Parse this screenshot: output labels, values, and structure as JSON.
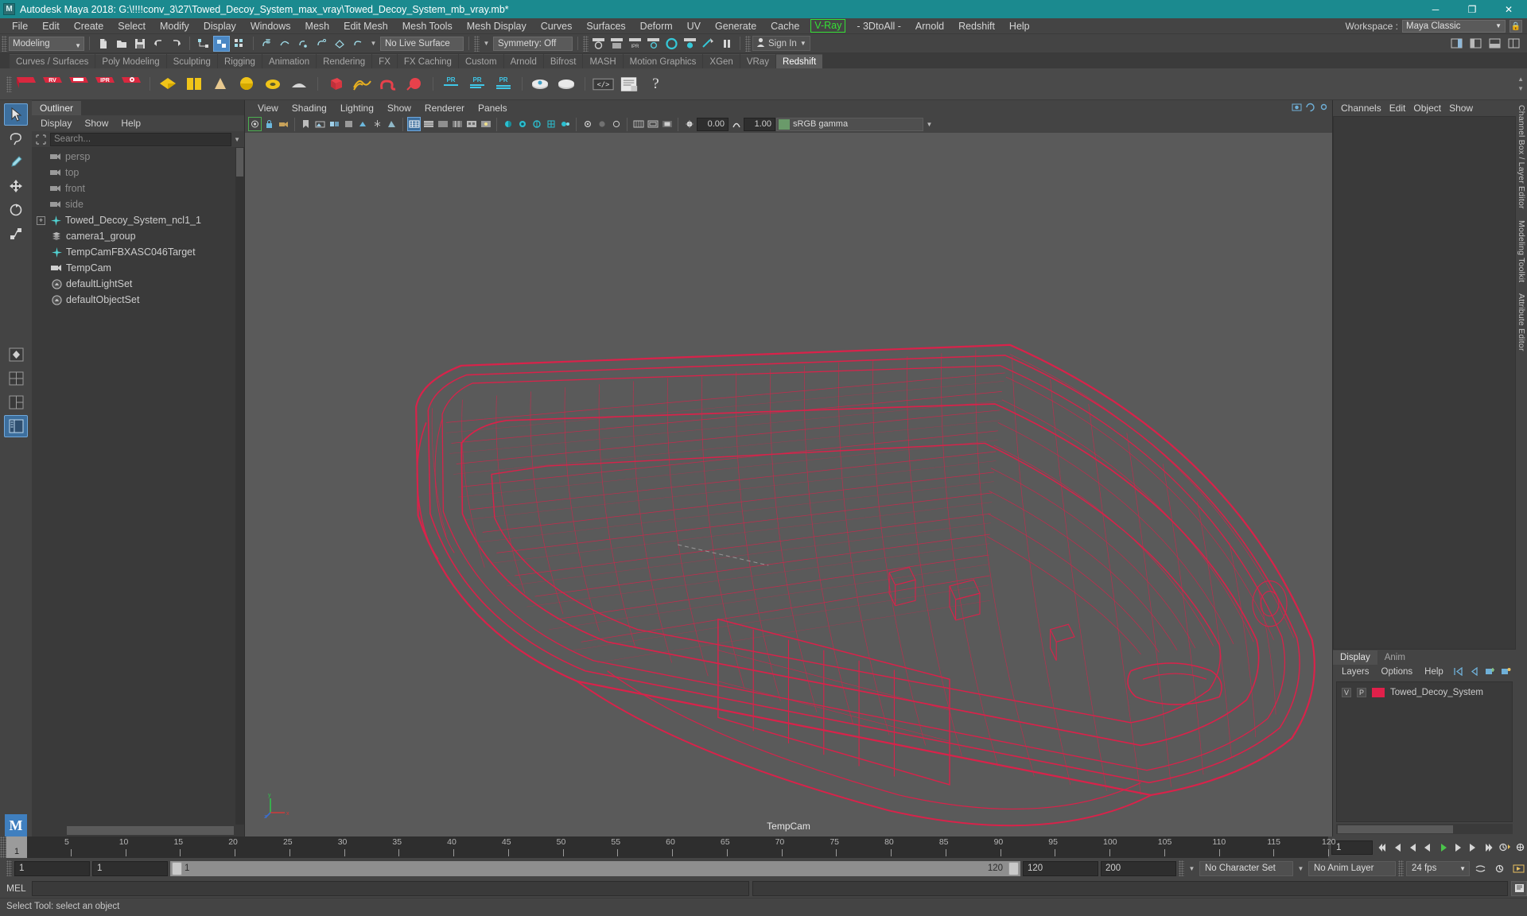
{
  "window": {
    "title": "Autodesk Maya 2018: G:\\!!!!conv_3\\27\\Towed_Decoy_System_max_vray\\Towed_Decoy_System_mb_vray.mb*",
    "app_icon": "maya-icon",
    "minimize": "─",
    "maximize": "❐",
    "close": "✕",
    "titlebar_color": "#1b8a8f"
  },
  "menubar": {
    "items": [
      "File",
      "Edit",
      "Create",
      "Select",
      "Modify",
      "Display",
      "Windows",
      "Mesh",
      "Edit Mesh",
      "Mesh Tools",
      "Mesh Display",
      "Curves",
      "Surfaces",
      "Deform",
      "UV",
      "Generate",
      "Cache"
    ],
    "vray": "V-Ray",
    "after_vray": [
      "- 3DtoAll -",
      "Arnold",
      "Redshift",
      "Help"
    ],
    "workspace_label": "Workspace :",
    "workspace_value": "Maya Classic",
    "vray_color": "#35e035"
  },
  "statusline": {
    "mode": "Modeling",
    "live_surface": "No Live Surface",
    "symmetry": "Symmetry: Off",
    "signin": "Sign In",
    "num1": "0.00",
    "num2": "1.00"
  },
  "shelf": {
    "tabs": [
      "Curves / Surfaces",
      "Poly Modeling",
      "Sculpting",
      "Rigging",
      "Animation",
      "Rendering",
      "FX",
      "FX Caching",
      "Custom",
      "Arnold",
      "Bifrost",
      "MASH",
      "Motion Graphics",
      "XGen",
      "VRay",
      "Redshift"
    ],
    "active_tab": "Redshift",
    "icon_labels": [
      "RV",
      "",
      "IPR",
      "",
      "",
      "",
      "",
      "",
      "",
      "",
      "",
      "",
      "",
      "",
      "",
      "PR",
      "PR",
      "PR",
      "",
      "",
      "",
      "",
      "?"
    ]
  },
  "outliner": {
    "tab": "Outliner",
    "menus": [
      "Display",
      "Show",
      "Help"
    ],
    "search_placeholder": "Search...",
    "items": [
      {
        "label": "persp",
        "icon": "camera-icon",
        "expandable": false,
        "dim": true
      },
      {
        "label": "top",
        "icon": "camera-icon",
        "expandable": false,
        "dim": true
      },
      {
        "label": "front",
        "icon": "camera-icon",
        "expandable": false,
        "dim": true
      },
      {
        "label": "side",
        "icon": "camera-icon",
        "expandable": false,
        "dim": true
      },
      {
        "label": "Towed_Decoy_System_ncl1_1",
        "icon": "transform-icon",
        "expandable": true,
        "dim": false
      },
      {
        "label": "camera1_group",
        "icon": "group-icon",
        "expandable": false,
        "dim": false
      },
      {
        "label": "TempCamFBXASC046Target",
        "icon": "transform-icon",
        "expandable": false,
        "dim": false
      },
      {
        "label": "TempCam",
        "icon": "camera-icon",
        "expandable": false,
        "dim": false
      },
      {
        "label": "defaultLightSet",
        "icon": "set-icon",
        "expandable": false,
        "dim": false
      },
      {
        "label": "defaultObjectSet",
        "icon": "set-icon",
        "expandable": false,
        "dim": false
      }
    ]
  },
  "viewport": {
    "menus": [
      "View",
      "Shading",
      "Lighting",
      "Show",
      "Renderer",
      "Panels"
    ],
    "exposure": "0.00",
    "gamma": "1.00",
    "color_space": "sRGB gamma",
    "camera_label": "TempCam",
    "axis_labels": {
      "x": "x",
      "y": "y",
      "z": "z"
    },
    "model_color": "#e0204a",
    "background_color": "#5a5a5a"
  },
  "rightpanel": {
    "tabs": [
      "Channels",
      "Edit",
      "Object",
      "Show"
    ],
    "lower_tabs": [
      "Display",
      "Anim"
    ],
    "lower_menus": [
      "Layers",
      "Options",
      "Help"
    ],
    "layer": {
      "v": "V",
      "p": "P",
      "name": "Towed_Decoy_System",
      "color": "#e0204a"
    },
    "side_tabs": [
      "Channel Box / Layer Editor",
      "Modeling Toolkit",
      "Attribute Editor"
    ]
  },
  "timeslider": {
    "current_frame": "1",
    "ticks": [
      {
        "label": "5",
        "pos": 5
      },
      {
        "label": "10",
        "pos": 10
      },
      {
        "label": "15",
        "pos": 15
      },
      {
        "label": "20",
        "pos": 20
      },
      {
        "label": "25",
        "pos": 25
      },
      {
        "label": "30",
        "pos": 30
      },
      {
        "label": "35",
        "pos": 35
      },
      {
        "label": "40",
        "pos": 40
      },
      {
        "label": "45",
        "pos": 45
      },
      {
        "label": "50",
        "pos": 50
      },
      {
        "label": "55",
        "pos": 55
      },
      {
        "label": "60",
        "pos": 60
      },
      {
        "label": "65",
        "pos": 65
      },
      {
        "label": "70",
        "pos": 70
      },
      {
        "label": "75",
        "pos": 75
      },
      {
        "label": "80",
        "pos": 80
      },
      {
        "label": "85",
        "pos": 85
      },
      {
        "label": "90",
        "pos": 90
      },
      {
        "label": "95",
        "pos": 95
      },
      {
        "label": "100",
        "pos": 100
      },
      {
        "label": "105",
        "pos": 105
      },
      {
        "label": "110",
        "pos": 110
      },
      {
        "label": "115",
        "pos": 115
      },
      {
        "label": "120",
        "pos": 120
      }
    ],
    "range_min": 1,
    "range_max": 120,
    "frame_field": "1"
  },
  "rangebar": {
    "start_field": "1",
    "start_field2": "1",
    "bar_start": "1",
    "bar_end": "120",
    "end_field": "120",
    "end_field2": "200",
    "character_set": "No Character Set",
    "anim_layer": "No Anim Layer",
    "fps": "24 fps"
  },
  "mel": {
    "label": "MEL",
    "input_value": "",
    "output_value": ""
  },
  "statusbar": {
    "text": "Select Tool: select an object"
  }
}
